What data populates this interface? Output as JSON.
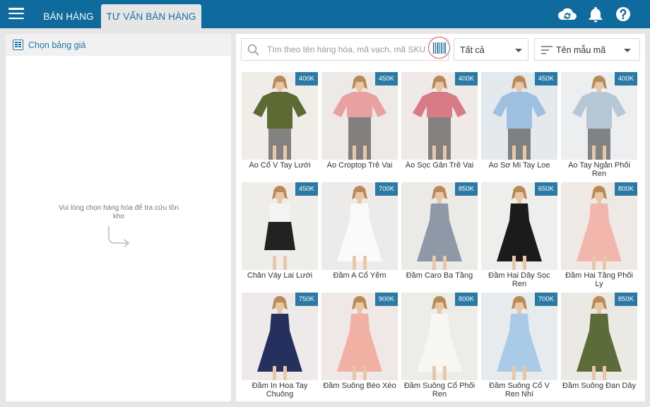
{
  "header": {
    "tabs": [
      {
        "label": "BÁN HÀNG",
        "active": false
      },
      {
        "label": "TƯ VẤN BÁN HÀNG",
        "active": true
      }
    ],
    "icons": [
      "menu-icon",
      "cloud-sync-icon",
      "bell-icon",
      "help-icon"
    ],
    "brand_color": "#0f6a9e"
  },
  "left_panel": {
    "header_label": "Chọn bảng giá",
    "empty_message": "Vui lòng chọn hàng hóa để tra cứu tồn kho"
  },
  "toolbar": {
    "search_placeholder": "Tìm theo tên hàng hóa, mã vạch, mã SKU",
    "search_value": "",
    "category_selected": "Tất cả",
    "sort_selected": "Tên mẫu mã"
  },
  "products": [
    {
      "name": "Áo Cổ V Tay Lưới",
      "price": "400K",
      "bg": "#f0ede8",
      "garment": "#5e6a33",
      "type": "top"
    },
    {
      "name": "Áo Croptop Trễ Vai",
      "price": "450K",
      "bg": "#ece9e6",
      "garment": "#e8a0a0",
      "type": "crop"
    },
    {
      "name": "Áo Sọc Gân Trễ Vai",
      "price": "400K",
      "bg": "#efe9e8",
      "garment": "#d97b86",
      "type": "crop"
    },
    {
      "name": "Áo Sơ Mi Tay Loe",
      "price": "450K",
      "bg": "#e4e9ee",
      "garment": "#9fc0e0",
      "type": "top"
    },
    {
      "name": "Áo Tay Ngắn Phối Ren",
      "price": "400K",
      "bg": "#eceef0",
      "garment": "#b7c7d6",
      "type": "top"
    },
    {
      "name": "Chân Váy Lai Lưới",
      "price": "450K",
      "bg": "#efedea",
      "garment": "#222222",
      "type": "skirt"
    },
    {
      "name": "Đầm A Cổ Yếm",
      "price": "700K",
      "bg": "#ecebe9",
      "garment": "#fafafa",
      "type": "dress"
    },
    {
      "name": "Đầm Caro Ba Tầng",
      "price": "850K",
      "bg": "#eceae6",
      "garment": "#8e98a6",
      "type": "dress"
    },
    {
      "name": "Đầm Hai Dây Sọc Ren",
      "price": "650K",
      "bg": "#eeeeec",
      "garment": "#1b1b1b",
      "type": "dress"
    },
    {
      "name": "Đầm Hai Tầng Phối Ly",
      "price": "800K",
      "bg": "#efe9e6",
      "garment": "#f2b6ad",
      "type": "dress"
    },
    {
      "name": "Đầm In Hoa Tay Chuông",
      "price": "750K",
      "bg": "#edeae9",
      "garment": "#25305e",
      "type": "dress"
    },
    {
      "name": "Đầm Suông Bèo Xéo",
      "price": "900K",
      "bg": "#efe8e6",
      "garment": "#f0b1a4",
      "type": "dress"
    },
    {
      "name": "Đầm Suông Cổ Phối Ren",
      "price": "800K",
      "bg": "#ecece9",
      "garment": "#f6f6f2",
      "type": "dress"
    },
    {
      "name": "Đầm Suông Cổ V Ren Nhí",
      "price": "700K",
      "bg": "#e8ebee",
      "garment": "#a9cbe8",
      "type": "dress"
    },
    {
      "name": "Đầm Suông Đan Dây",
      "price": "850K",
      "bg": "#ebe9e4",
      "garment": "#5c6b3a",
      "type": "dress"
    }
  ]
}
